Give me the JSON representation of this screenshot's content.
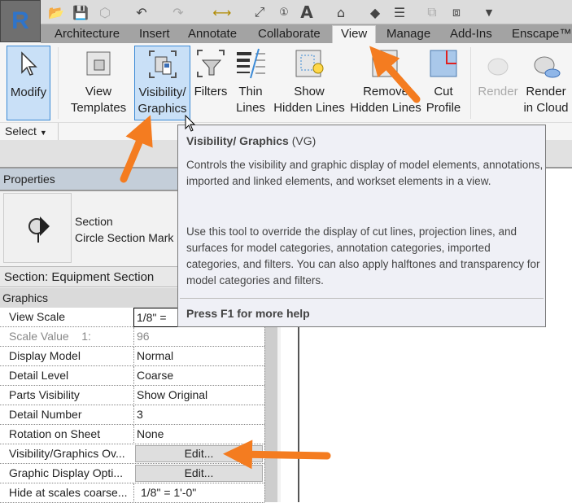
{
  "app": {
    "logo_letter": "R"
  },
  "quick_access": [
    "open-icon",
    "save-icon",
    "sync-icon",
    "undo-icon",
    "redo-icon",
    "measure-icon",
    "dimension-icon",
    "tag-icon",
    "text-icon",
    "3d-view-icon",
    "section-icon",
    "thin-lines-icon",
    "close-hidden-icon",
    "switch-windows-icon",
    "customize-icon"
  ],
  "tabs": [
    {
      "label": "Architecture"
    },
    {
      "label": "Insert"
    },
    {
      "label": "Annotate"
    },
    {
      "label": "Collaborate"
    },
    {
      "label": "View",
      "active": true
    },
    {
      "label": "Manage"
    },
    {
      "label": "Add-Ins"
    },
    {
      "label": "Enscape™"
    }
  ],
  "ribbon": {
    "modify": "Modify",
    "view_templates": [
      "View",
      "Templates"
    ],
    "visibility_graphics": [
      "Visibility/",
      "Graphics"
    ],
    "filters": "Filters",
    "thin_lines": [
      "Thin",
      "Lines"
    ],
    "show_hidden": [
      "Show",
      "Hidden Lines"
    ],
    "remove_hidden": [
      "Remove",
      "Hidden Lines"
    ],
    "cut_profile": [
      "Cut",
      "Profile"
    ],
    "render": "Render",
    "render_cloud": [
      "Render",
      "in Cloud"
    ],
    "select": "Select"
  },
  "tooltip": {
    "title": "Visibility/ Graphics",
    "shortcut": "(VG)",
    "para1": "Controls the visibility and graphic display of model elements, annotations, imported and linked elements, and workset elements in a view.",
    "para2": "Use this tool to override the display of cut lines, projection lines, and surfaces for model categories, annotation categories, imported categories, and filters. You can also apply halftones and transparency for model categories and filters.",
    "help": "Press F1 for more help"
  },
  "properties": {
    "title": "Properties",
    "type_family": "Section",
    "type_name": "Circle Section Mark",
    "selector": "Section: Equipment Section",
    "group": "Graphics",
    "rows": [
      {
        "key": "View Scale",
        "value": "1/8\" ="
      },
      {
        "key": "Scale Value    1:",
        "value": "96"
      },
      {
        "key": "Display Model",
        "value": "Normal"
      },
      {
        "key": "Detail Level",
        "value": "Coarse"
      },
      {
        "key": "Parts Visibility",
        "value": "Show Original"
      },
      {
        "key": "Detail Number",
        "value": "3"
      },
      {
        "key": "Rotation on Sheet",
        "value": "None"
      },
      {
        "key": "Visibility/Graphics Ov...",
        "value": "Edit..."
      },
      {
        "key": "Graphic Display Opti...",
        "value": "Edit..."
      },
      {
        "key": "Hide at scales coarse...",
        "value": "1/8\" = 1'-0\""
      }
    ]
  },
  "colors": {
    "accent_arrow": "#f47c20",
    "selected": "#c9e0f7",
    "tooltip_bg": "#eff0f6"
  }
}
